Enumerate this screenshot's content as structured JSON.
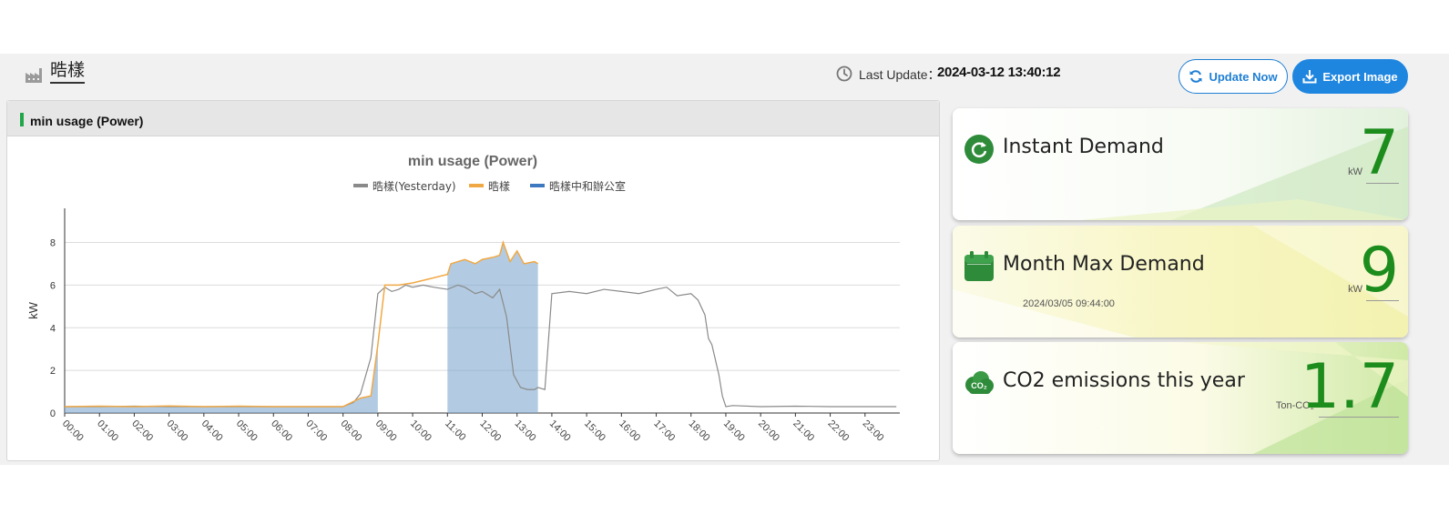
{
  "header": {
    "site_name": "晧樣",
    "last_update_label": "Last Update：",
    "last_update_value": "2024-03-12 13:40:12",
    "update_button": "Update Now",
    "export_button": "Export Image"
  },
  "panel": {
    "title": "min usage (Power)"
  },
  "chart_data": {
    "type": "area",
    "title": "min usage (Power)",
    "ylabel": "kW",
    "xlabel": "",
    "ylim": [
      0,
      9.6
    ],
    "yticks": [
      0,
      2,
      4,
      6,
      8
    ],
    "grid": true,
    "legend_position": "top",
    "x_tick_labels": [
      "00:00",
      "01:00",
      "02:00",
      "03:00",
      "04:00",
      "05:00",
      "06:00",
      "07:00",
      "08:00",
      "09:00",
      "10:00",
      "11:00",
      "12:00",
      "13:00",
      "14:00",
      "15:00",
      "16:00",
      "17:00",
      "18:00",
      "19:00",
      "20:00",
      "21:00",
      "22:00",
      "23:00"
    ],
    "series": [
      {
        "name": "晧樣(Yesterday)",
        "color": "#8a8a8a",
        "x": [
          0,
          1,
          2,
          3,
          4,
          5,
          6,
          7,
          8,
          8.3,
          8.5,
          8.8,
          9.0,
          9.2,
          9.4,
          9.6,
          9.8,
          10.0,
          10.3,
          10.6,
          11.0,
          11.3,
          11.5,
          11.8,
          12.0,
          12.3,
          12.5,
          12.7,
          12.9,
          13.1,
          13.3,
          13.5,
          13.6,
          13.8,
          14.0,
          14.5,
          15.0,
          15.5,
          16.0,
          16.5,
          17.0,
          17.3,
          17.6,
          18.0,
          18.2,
          18.4,
          18.5,
          18.6,
          18.8,
          18.9,
          19.0,
          19.2,
          20,
          21,
          22,
          23,
          23.9
        ],
        "y": [
          0.3,
          0.3,
          0.32,
          0.3,
          0.3,
          0.3,
          0.3,
          0.3,
          0.3,
          0.5,
          0.9,
          2.6,
          5.6,
          5.9,
          5.7,
          5.8,
          6.0,
          5.9,
          6.0,
          5.9,
          5.8,
          6.0,
          5.9,
          5.6,
          5.7,
          5.4,
          5.8,
          4.5,
          1.8,
          1.2,
          1.1,
          1.1,
          1.2,
          1.1,
          5.6,
          5.7,
          5.6,
          5.8,
          5.7,
          5.6,
          5.8,
          5.9,
          5.5,
          5.6,
          5.3,
          4.6,
          3.5,
          3.2,
          1.8,
          0.8,
          0.3,
          0.35,
          0.3,
          0.32,
          0.3,
          0.3,
          0.3
        ]
      },
      {
        "name": "晧樣",
        "color": "#f0a845",
        "x": [
          0,
          1,
          2,
          3,
          4,
          5,
          6,
          7,
          8,
          8.5,
          8.8,
          9.0,
          9.2,
          9.5,
          9.6,
          10.0,
          10.5,
          11.0,
          11.1,
          11.3,
          11.5,
          11.8,
          12.0,
          12.3,
          12.5,
          12.6,
          12.8,
          13.0,
          13.2,
          13.5,
          13.6
        ],
        "y": [
          0.3,
          0.32,
          0.3,
          0.33,
          0.3,
          0.32,
          0.3,
          0.3,
          0.3,
          0.7,
          0.8,
          3.2,
          6.0,
          6.0,
          6.0,
          6.1,
          6.3,
          6.5,
          7.0,
          7.1,
          7.2,
          7.0,
          7.2,
          7.3,
          7.4,
          8.0,
          7.1,
          7.6,
          7.0,
          7.1,
          7.0
        ]
      },
      {
        "name": "晧樣中和辦公室",
        "color": "#3e78bf",
        "x": [],
        "y": []
      }
    ]
  },
  "cards": [
    {
      "label": "Instant Demand",
      "value": "7",
      "unit": "kW",
      "sub": "",
      "icon": "refresh-icon",
      "accent": "#2e8b3a"
    },
    {
      "label": "Month Max Demand",
      "value": "9",
      "unit": "kW",
      "sub": "2024/03/05 09:44:00",
      "icon": "calendar-icon",
      "accent": "#2e8b3a"
    },
    {
      "label": "CO2 emissions this year",
      "value": "1.7",
      "unit": "Ton-CO₂",
      "sub": "",
      "icon": "co2-cloud-icon",
      "accent": "#2e8b3a"
    }
  ]
}
